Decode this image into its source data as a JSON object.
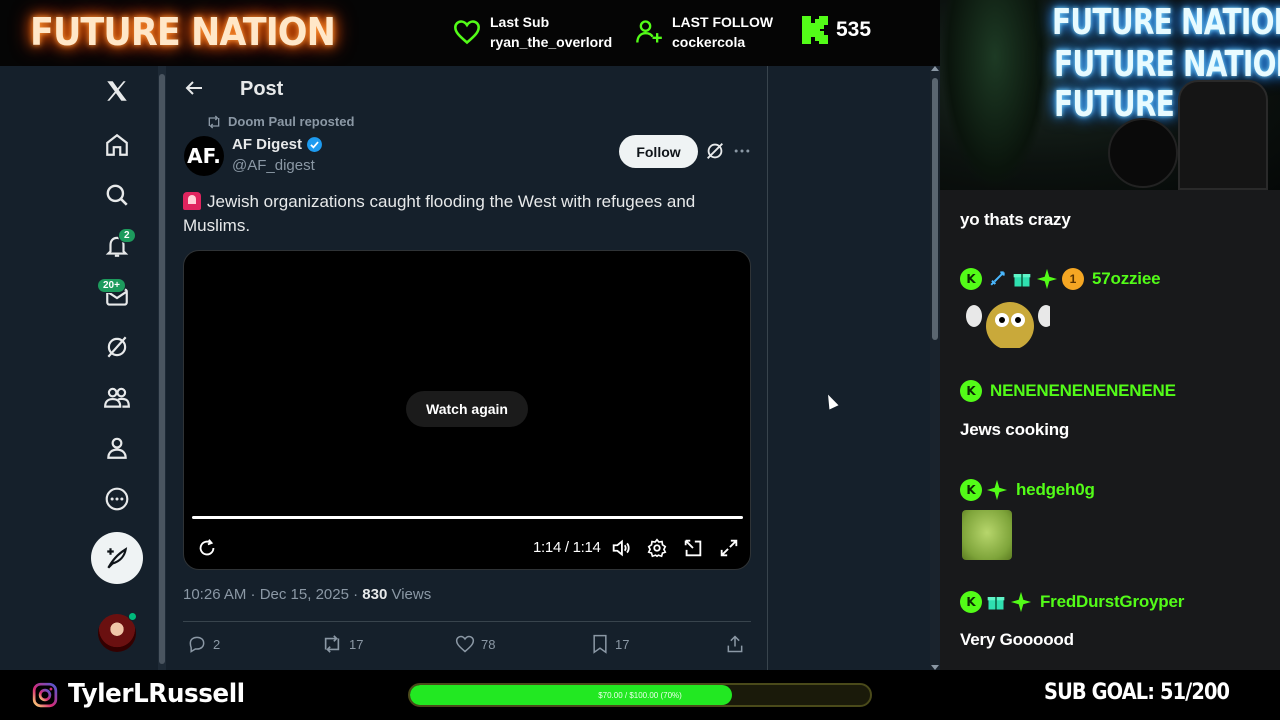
{
  "stream": {
    "brand": "FUTURE NATION",
    "last_sub_label": "Last Sub",
    "last_sub_value": "ryan_the_overlord",
    "last_follow_label": "LAST FOLLOW",
    "last_follow_value": "cockercola",
    "kick_count": "535",
    "accent_color": "#53fc18"
  },
  "nav": {
    "notifications_badge": "2",
    "messages_badge": "20+"
  },
  "post": {
    "header_title": "Post",
    "repost_text": "Doom Paul reposted",
    "author_initials": "AF.",
    "author_name": "AF Digest",
    "author_handle": "@AF_digest",
    "follow_label": "Follow",
    "text": "Jewish organizations caught flooding the West with refugees and Muslims.",
    "video": {
      "watch_again_label": "Watch again",
      "time": "1:14 / 1:14",
      "progress": 1.0
    },
    "meta_time": "10:26 AM · Dec 15, 2025 · ",
    "meta_views": "830",
    "meta_views_label": " Views",
    "replies": "2",
    "reposts": "17",
    "likes": "78",
    "bookmarks": "17"
  },
  "webcam": {
    "neon_lines": [
      "FUTURE NATION",
      "FUTURE NATION",
      "FUTURE NA"
    ]
  },
  "chat": {
    "messages": [
      {
        "user": "",
        "text": "yo thats crazy"
      },
      {
        "user": "57ozziee",
        "text": ""
      },
      {
        "user": "NENENENENENENENE",
        "text": "Jews cooking"
      },
      {
        "user": "hedgeh0g",
        "text": ""
      },
      {
        "user": "FredDurstGroyper",
        "text": "Very Goooood"
      }
    ]
  },
  "bottom": {
    "instagram_name": "TylerLRussell",
    "goal_text": "$70.00 / $100.00 (70%)",
    "goal_progress": 0.7,
    "sub_goal": "SUB GOAL: 51/200",
    "goal_color": "#22e822"
  }
}
